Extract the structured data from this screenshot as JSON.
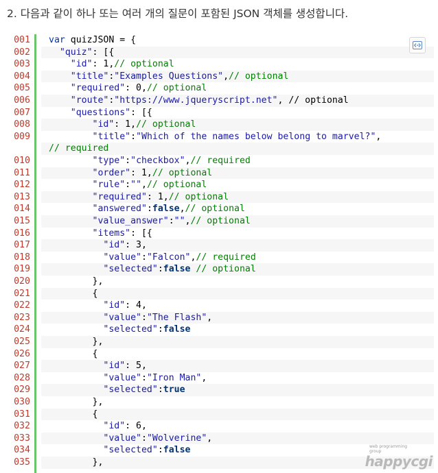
{
  "heading": "2. 다음과 같이 하나 또는 여러 개의 질문이 포함된 JSON 객체를 생성합니다.",
  "copy_button": {
    "icon": "view-source-icon"
  },
  "watermark": {
    "small": "web programming group",
    "big": "happycgi"
  },
  "colors": {
    "line_number": "#c0392b",
    "gutter_bar": "#6ac46a",
    "keyword": "#0033aa",
    "string": "#1a1aa6",
    "comment": "#008000",
    "boolean": "#003377",
    "alt_row": "#f6f6f6"
  },
  "code_lines": [
    {
      "num": "001",
      "tokens": [
        [
          "kw",
          "var"
        ],
        [
          "plain",
          " quizJSON = {"
        ]
      ]
    },
    {
      "num": "002",
      "tokens": [
        [
          "plain",
          "  "
        ],
        [
          "str",
          "\"quiz\""
        ],
        [
          "plain",
          ": [{"
        ]
      ]
    },
    {
      "num": "003",
      "tokens": [
        [
          "plain",
          "    "
        ],
        [
          "str",
          "\"id\""
        ],
        [
          "plain",
          ": 1,"
        ],
        [
          "cm",
          "// optional"
        ]
      ]
    },
    {
      "num": "004",
      "tokens": [
        [
          "plain",
          "    "
        ],
        [
          "str",
          "\"title\""
        ],
        [
          "plain",
          ":"
        ],
        [
          "str",
          "\"Examples Questions\""
        ],
        [
          "plain",
          ","
        ],
        [
          "cm",
          "// optional"
        ]
      ]
    },
    {
      "num": "005",
      "tokens": [
        [
          "plain",
          "    "
        ],
        [
          "str",
          "\"required\""
        ],
        [
          "plain",
          ": 0,"
        ],
        [
          "cm",
          "// optional"
        ]
      ]
    },
    {
      "num": "006",
      "tokens": [
        [
          "plain",
          "    "
        ],
        [
          "str",
          "\"route\""
        ],
        [
          "plain",
          ":"
        ],
        [
          "str",
          "\"https://www.jqueryscript.net\""
        ],
        [
          "plain",
          ", // optional"
        ]
      ]
    },
    {
      "num": "007",
      "tokens": [
        [
          "plain",
          "    "
        ],
        [
          "str",
          "\"questions\""
        ],
        [
          "plain",
          ": [{"
        ]
      ]
    },
    {
      "num": "008",
      "tokens": [
        [
          "plain",
          "        "
        ],
        [
          "str",
          "\"id\""
        ],
        [
          "plain",
          ": 1,"
        ],
        [
          "cm",
          "// optional"
        ]
      ]
    },
    {
      "num": "009",
      "tokens": [
        [
          "plain",
          "        "
        ],
        [
          "str",
          "\"title\""
        ],
        [
          "plain",
          ":"
        ],
        [
          "str",
          "\"Which of the names below belong to marvel?\""
        ],
        [
          "plain",
          ","
        ]
      ]
    },
    {
      "num": "",
      "tokens": [
        [
          "cm",
          "// required"
        ]
      ]
    },
    {
      "num": "010",
      "tokens": [
        [
          "plain",
          "        "
        ],
        [
          "str",
          "\"type\""
        ],
        [
          "plain",
          ":"
        ],
        [
          "str",
          "\"checkbox\""
        ],
        [
          "plain",
          ","
        ],
        [
          "cm",
          "// required"
        ]
      ]
    },
    {
      "num": "011",
      "tokens": [
        [
          "plain",
          "        "
        ],
        [
          "str",
          "\"order\""
        ],
        [
          "plain",
          ": 1,"
        ],
        [
          "cm",
          "// optional"
        ]
      ]
    },
    {
      "num": "012",
      "tokens": [
        [
          "plain",
          "        "
        ],
        [
          "str",
          "\"rule\""
        ],
        [
          "plain",
          ":"
        ],
        [
          "str",
          "\"\""
        ],
        [
          "plain",
          ","
        ],
        [
          "cm",
          "// optional"
        ]
      ]
    },
    {
      "num": "013",
      "tokens": [
        [
          "plain",
          "        "
        ],
        [
          "str",
          "\"required\""
        ],
        [
          "plain",
          ": 1,"
        ],
        [
          "cm",
          "// optional"
        ]
      ]
    },
    {
      "num": "014",
      "tokens": [
        [
          "plain",
          "        "
        ],
        [
          "str",
          "\"answered\""
        ],
        [
          "plain",
          ":"
        ],
        [
          "bool",
          "false"
        ],
        [
          "plain",
          ","
        ],
        [
          "cm",
          "// optional"
        ]
      ]
    },
    {
      "num": "015",
      "tokens": [
        [
          "plain",
          "        "
        ],
        [
          "str",
          "\"value_answer\""
        ],
        [
          "plain",
          ":"
        ],
        [
          "str",
          "\"\""
        ],
        [
          "plain",
          ","
        ],
        [
          "cm",
          "// optional"
        ]
      ]
    },
    {
      "num": "016",
      "tokens": [
        [
          "plain",
          "        "
        ],
        [
          "str",
          "\"items\""
        ],
        [
          "plain",
          ": [{"
        ]
      ]
    },
    {
      "num": "017",
      "tokens": [
        [
          "plain",
          "          "
        ],
        [
          "str",
          "\"id\""
        ],
        [
          "plain",
          ": 3,"
        ]
      ]
    },
    {
      "num": "018",
      "tokens": [
        [
          "plain",
          "          "
        ],
        [
          "str",
          "\"value\""
        ],
        [
          "plain",
          ":"
        ],
        [
          "str",
          "\"Falcon\""
        ],
        [
          "plain",
          ","
        ],
        [
          "cm",
          "// required"
        ]
      ]
    },
    {
      "num": "019",
      "tokens": [
        [
          "plain",
          "          "
        ],
        [
          "str",
          "\"selected\""
        ],
        [
          "plain",
          ":"
        ],
        [
          "bool",
          "false"
        ],
        [
          "plain",
          " "
        ],
        [
          "cm",
          "// optional"
        ]
      ]
    },
    {
      "num": "020",
      "tokens": [
        [
          "plain",
          "        },"
        ]
      ]
    },
    {
      "num": "021",
      "tokens": [
        [
          "plain",
          "        {"
        ]
      ]
    },
    {
      "num": "022",
      "tokens": [
        [
          "plain",
          "          "
        ],
        [
          "str",
          "\"id\""
        ],
        [
          "plain",
          ": 4,"
        ]
      ]
    },
    {
      "num": "023",
      "tokens": [
        [
          "plain",
          "          "
        ],
        [
          "str",
          "\"value\""
        ],
        [
          "plain",
          ":"
        ],
        [
          "str",
          "\"The Flash\""
        ],
        [
          "plain",
          ","
        ]
      ]
    },
    {
      "num": "024",
      "tokens": [
        [
          "plain",
          "          "
        ],
        [
          "str",
          "\"selected\""
        ],
        [
          "plain",
          ":"
        ],
        [
          "bool",
          "false"
        ]
      ]
    },
    {
      "num": "025",
      "tokens": [
        [
          "plain",
          "        },"
        ]
      ]
    },
    {
      "num": "026",
      "tokens": [
        [
          "plain",
          "        {"
        ]
      ]
    },
    {
      "num": "027",
      "tokens": [
        [
          "plain",
          "          "
        ],
        [
          "str",
          "\"id\""
        ],
        [
          "plain",
          ": 5,"
        ]
      ]
    },
    {
      "num": "028",
      "tokens": [
        [
          "plain",
          "          "
        ],
        [
          "str",
          "\"value\""
        ],
        [
          "plain",
          ":"
        ],
        [
          "str",
          "\"Iron Man\""
        ],
        [
          "plain",
          ","
        ]
      ]
    },
    {
      "num": "029",
      "tokens": [
        [
          "plain",
          "          "
        ],
        [
          "str",
          "\"selected\""
        ],
        [
          "plain",
          ":"
        ],
        [
          "bool",
          "true"
        ]
      ]
    },
    {
      "num": "030",
      "tokens": [
        [
          "plain",
          "        },"
        ]
      ]
    },
    {
      "num": "031",
      "tokens": [
        [
          "plain",
          "        {"
        ]
      ]
    },
    {
      "num": "032",
      "tokens": [
        [
          "plain",
          "          "
        ],
        [
          "str",
          "\"id\""
        ],
        [
          "plain",
          ": 6,"
        ]
      ]
    },
    {
      "num": "033",
      "tokens": [
        [
          "plain",
          "          "
        ],
        [
          "str",
          "\"value\""
        ],
        [
          "plain",
          ":"
        ],
        [
          "str",
          "\"Wolverine\""
        ],
        [
          "plain",
          ","
        ]
      ]
    },
    {
      "num": "034",
      "tokens": [
        [
          "plain",
          "          "
        ],
        [
          "str",
          "\"selected\""
        ],
        [
          "plain",
          ":"
        ],
        [
          "bool",
          "false"
        ]
      ]
    },
    {
      "num": "035",
      "tokens": [
        [
          "plain",
          "        },"
        ]
      ]
    }
  ]
}
